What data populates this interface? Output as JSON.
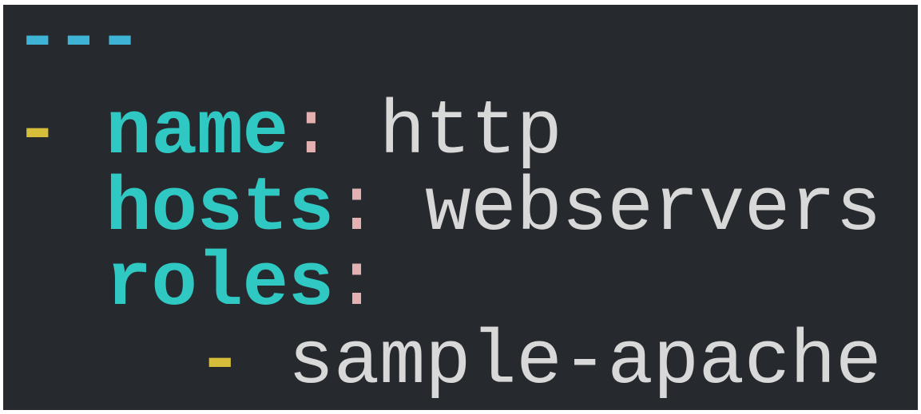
{
  "editor": {
    "lines": [
      {
        "marker": "---"
      },
      {
        "indent": "",
        "dash": "-",
        "key": "name",
        "colon": ":",
        "value": "http"
      },
      {
        "indent": "  ",
        "key": "hosts",
        "colon": ":",
        "value": "webservers"
      },
      {
        "indent": "  ",
        "key": "roles",
        "colon": ":"
      },
      {
        "indent": "    ",
        "dash": "-",
        "value": "sample-apache"
      }
    ]
  },
  "colors": {
    "background": "#26292d",
    "doc_marker": "#3fb3d6",
    "dash": "#d6bd3a",
    "key": "#2fc8c3",
    "colon": "#e3b1b1",
    "value": "#d8d8d8"
  }
}
